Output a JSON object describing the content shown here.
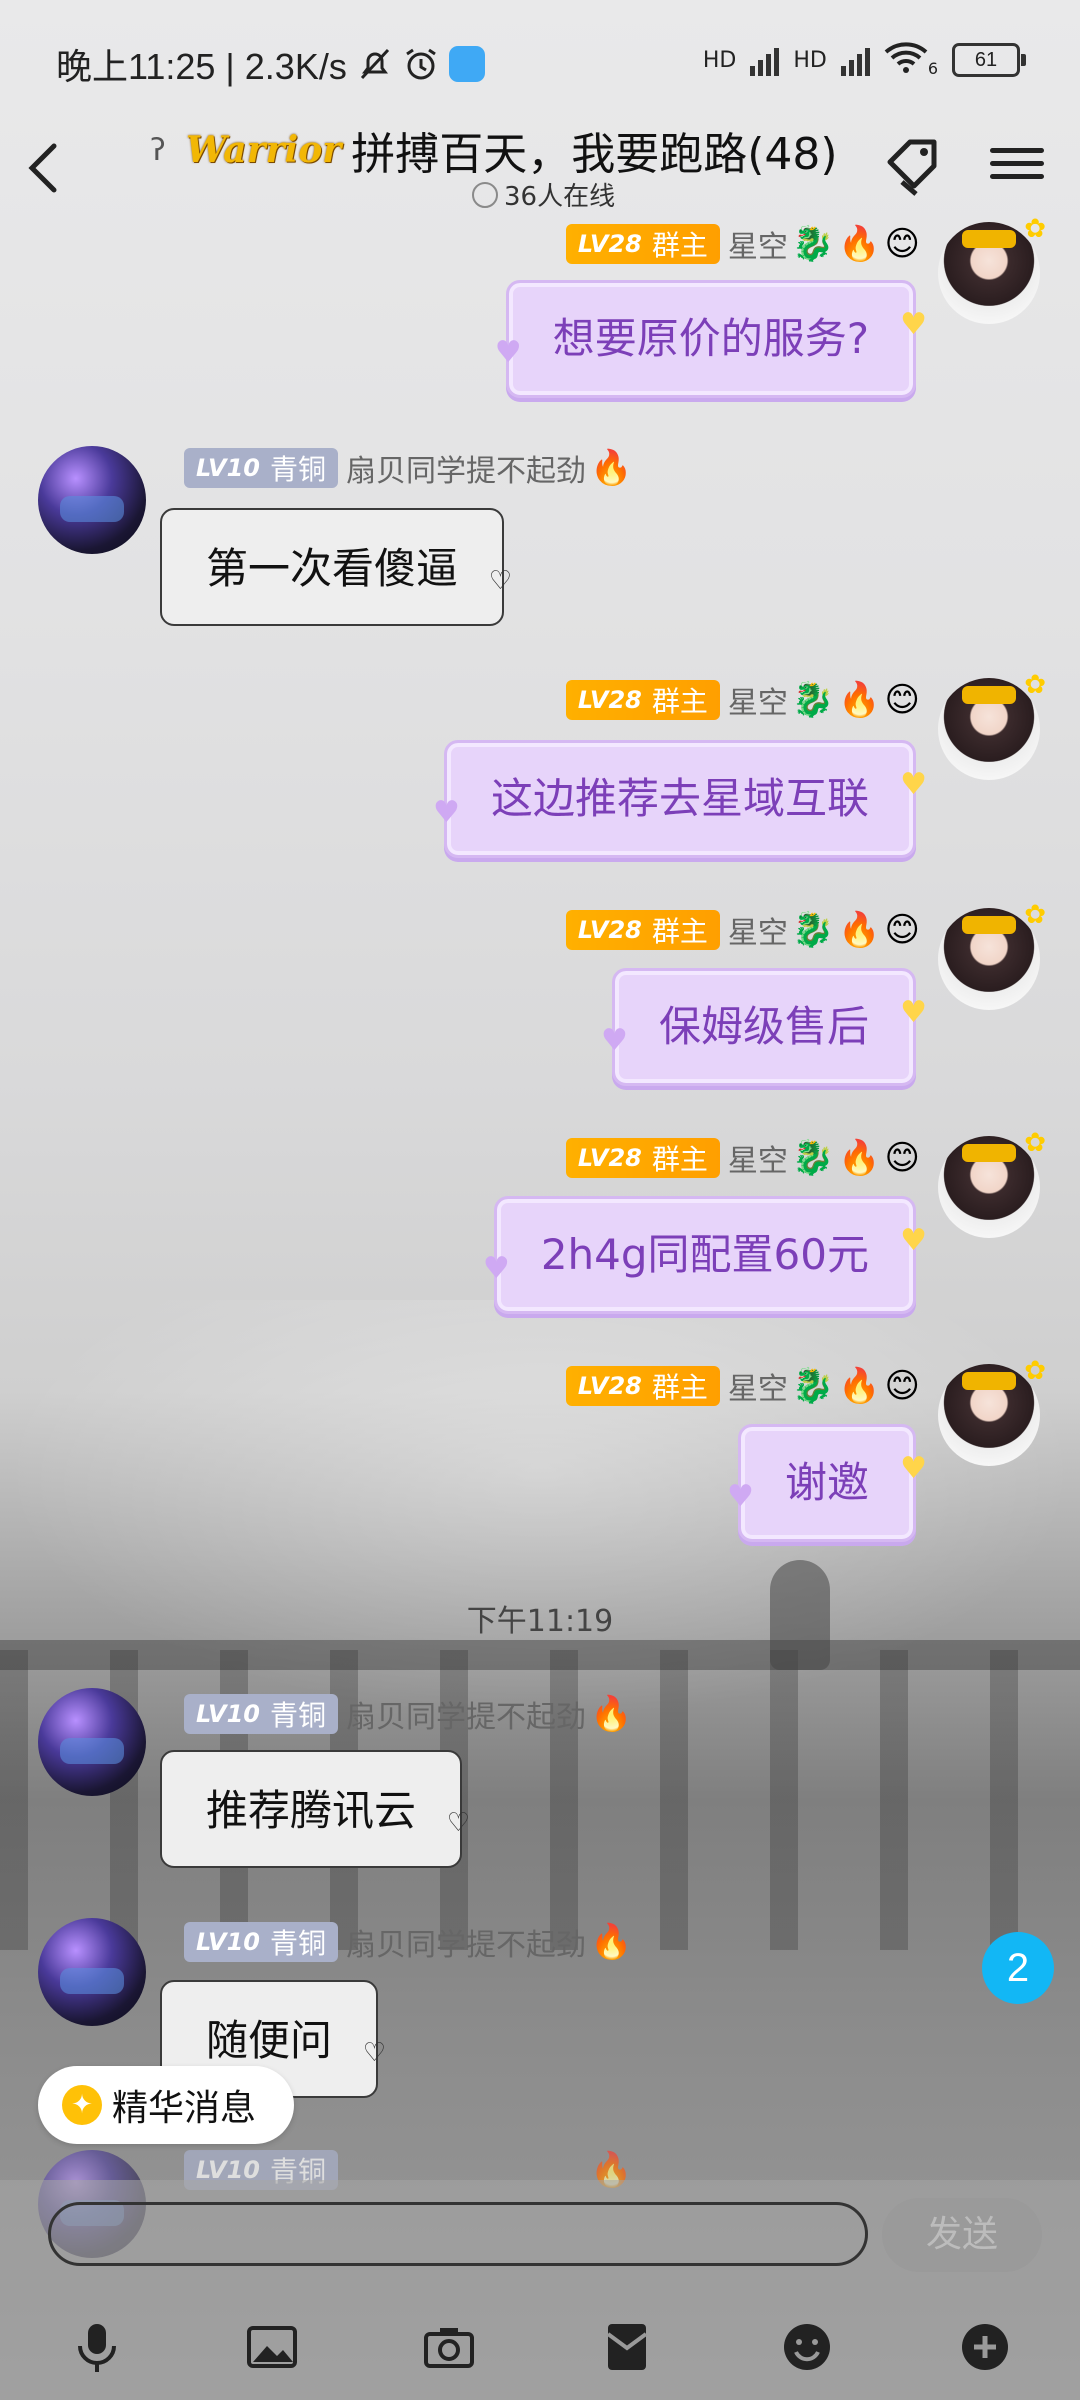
{
  "status_bar": {
    "time_speed": "晚上11:25 | 2.3K/s",
    "battery": "61",
    "network_label": "HD",
    "wifi_sub": "6"
  },
  "header": {
    "badge_text": "Warrior",
    "title": "拼搏百天，我要跑路(48)",
    "online": "36人在线"
  },
  "badges": {
    "lv10_level": "LV10",
    "lv10_title": "青铜",
    "lv28_level": "LV28",
    "lv28_title": "群主"
  },
  "users": {
    "owner_nick": "星空",
    "member_nick": "扇贝同学提不起劲"
  },
  "messages": [
    {
      "side": "right",
      "text": "想要原价的服务?"
    },
    {
      "side": "left",
      "text": "第一次看傻逼"
    },
    {
      "side": "right",
      "text": "这边推荐去星域互联"
    },
    {
      "side": "right",
      "text": "保姆级售后"
    },
    {
      "side": "right",
      "text": "2h4g同配置60元"
    },
    {
      "side": "right",
      "text": "谢邀"
    },
    {
      "side": "left",
      "text": "推荐腾讯云"
    },
    {
      "side": "left",
      "text": "随便问"
    }
  ],
  "timestamp": "下午11:19",
  "unread_count": "2",
  "essence_label": "精华消息",
  "input": {
    "placeholder": "",
    "send_label": "发送"
  },
  "colors": {
    "owner_bubble_bg": "#e7d4fa",
    "owner_bubble_text": "#7c3fb8",
    "member_bubble_bg": "#eeeeee",
    "owner_badge": "#ffa800",
    "member_badge": "#a9b0c9",
    "unread_badge": "#12b7f5"
  },
  "icons": {
    "toolbar": [
      "microphone-icon",
      "image-icon",
      "camera-icon",
      "red-packet-icon",
      "emoji-icon",
      "plus-icon"
    ]
  }
}
